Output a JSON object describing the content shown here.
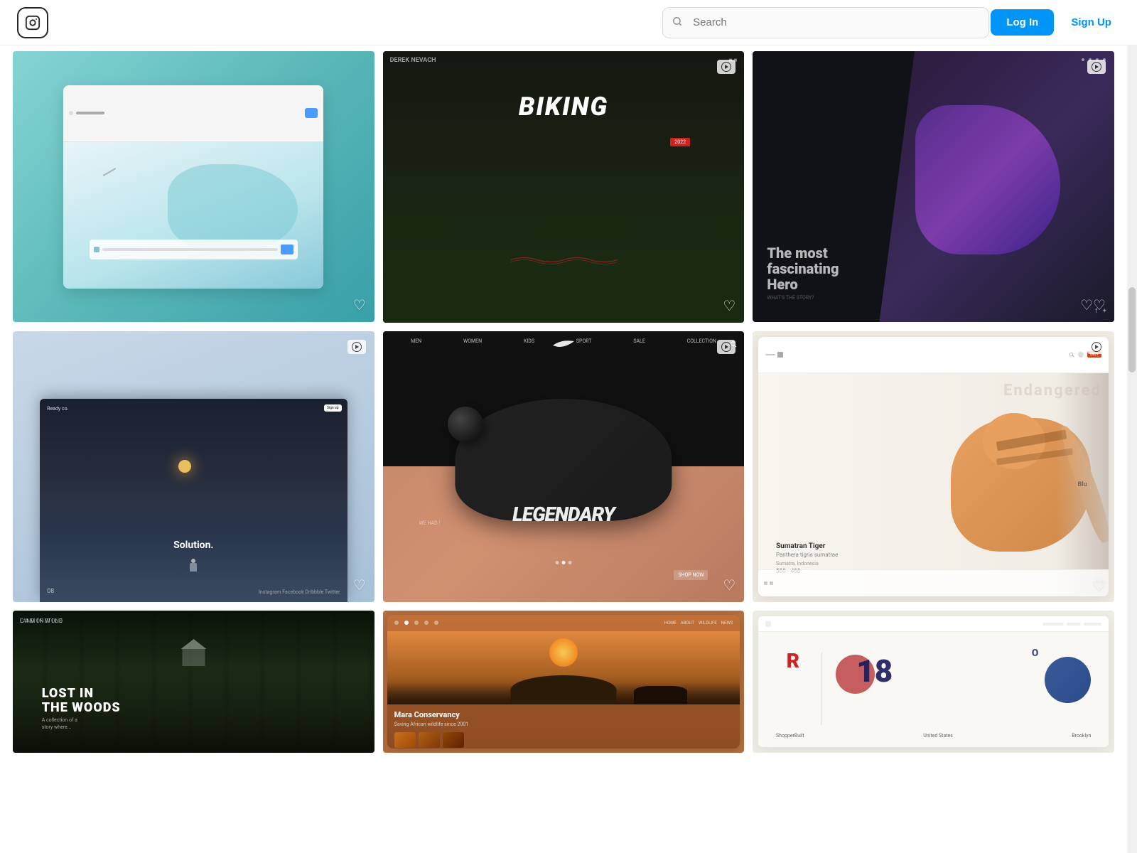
{
  "header": {
    "logo_label": "Instagram",
    "search_placeholder": "Search",
    "login_label": "Log In",
    "signup_label": "Sign Up"
  },
  "grid": {
    "rows": [
      {
        "cards": [
          {
            "id": "card-1",
            "type": "image",
            "alt": "Travel booking app UI",
            "show_heart": true,
            "heart_visible": true
          },
          {
            "id": "card-2",
            "type": "image",
            "alt": "Biking website design",
            "show_heart": true,
            "show_video": true
          },
          {
            "id": "card-3",
            "type": "image",
            "alt": "Dark hero UI design",
            "show_heart": true,
            "show_video": true
          }
        ]
      },
      {
        "cards": [
          {
            "id": "card-4",
            "type": "image",
            "alt": "Solution mountain website",
            "show_heart": true,
            "show_video": true
          },
          {
            "id": "card-5",
            "type": "image",
            "alt": "Nike Legendary shoe design",
            "show_heart": true,
            "show_video": true
          },
          {
            "id": "card-6",
            "type": "image",
            "alt": "Endangered species website",
            "show_heart": true,
            "show_video": true
          }
        ]
      },
      {
        "cards": [
          {
            "id": "card-7",
            "type": "image",
            "alt": "Lost in the Woods website",
            "show_heart": false
          },
          {
            "id": "card-8",
            "type": "image",
            "alt": "Mara Conservancy website",
            "show_heart": false
          },
          {
            "id": "card-9",
            "type": "image",
            "alt": "R18 graphic design",
            "show_heart": false
          }
        ]
      }
    ],
    "card_texts": {
      "card2_title": "Biking",
      "card4_solution": "Solution.",
      "card4_logo": "Ready co.",
      "card4_number": "08",
      "card4_socials": "Instagram  Facebook  Dribbble  Twitter",
      "card5_legendary": "LEGENDARY",
      "card5_logo": "Nike",
      "card6_endangered": "Endangered",
      "card6_species": "Sumatran Tiger",
      "card6_latin": "Panthera tigris sumatrae",
      "card6_location": "Sumatra, Indonesia",
      "card6_population": "300 - 400",
      "card7_title": "LOST IN\nTHE WOODS",
      "card7_label": "CAMINWILD",
      "card7_sublabel": "LAND OF STONE",
      "card7_desc": "A collection of a story where...",
      "card8_mara": "Mara Conservancy",
      "card8_desc": "Saving African wildlife since 2001",
      "card9_r": "R",
      "card9_number": "18",
      "card9_o": "O"
    }
  }
}
